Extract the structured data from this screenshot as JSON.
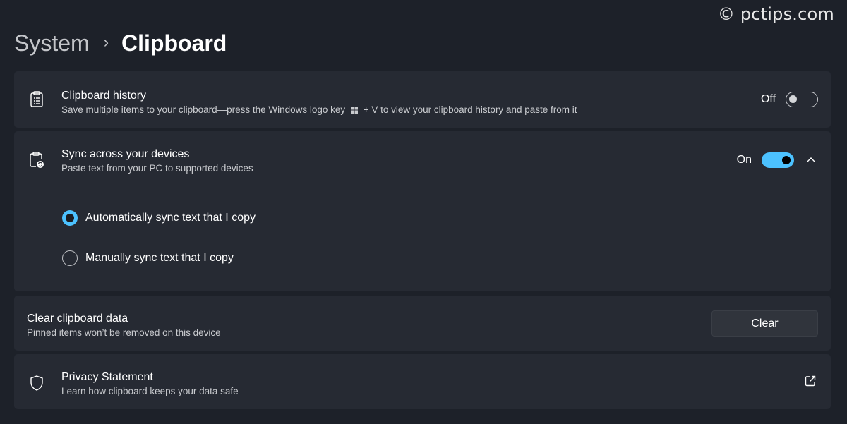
{
  "watermark": "© pctips.com",
  "breadcrumb": {
    "parent": "System",
    "separator": "›",
    "current": "Clipboard"
  },
  "clipboard_history": {
    "title": "Clipboard history",
    "description_before": "Save multiple items to your clipboard—press the Windows logo key",
    "description_after": "+ V to view your clipboard history and paste from it",
    "state_label": "Off",
    "enabled": false,
    "icon": "clipboard-list-icon"
  },
  "sync": {
    "title": "Sync across your devices",
    "description": "Paste text from your PC to supported devices",
    "state_label": "On",
    "enabled": true,
    "expanded": true,
    "icon": "clipboard-sync-icon",
    "options": [
      {
        "label": "Automatically sync text that I copy",
        "selected": true
      },
      {
        "label": "Manually sync text that I copy",
        "selected": false
      }
    ]
  },
  "clear_data": {
    "title": "Clear clipboard data",
    "description": "Pinned items won’t be removed on this device",
    "button_label": "Clear"
  },
  "privacy": {
    "title": "Privacy Statement",
    "description": "Learn how clipboard keeps your data safe",
    "icon": "shield-icon"
  },
  "colors": {
    "accent": "#4cc2ff",
    "background": "#1d2129",
    "card": "#262a33"
  }
}
